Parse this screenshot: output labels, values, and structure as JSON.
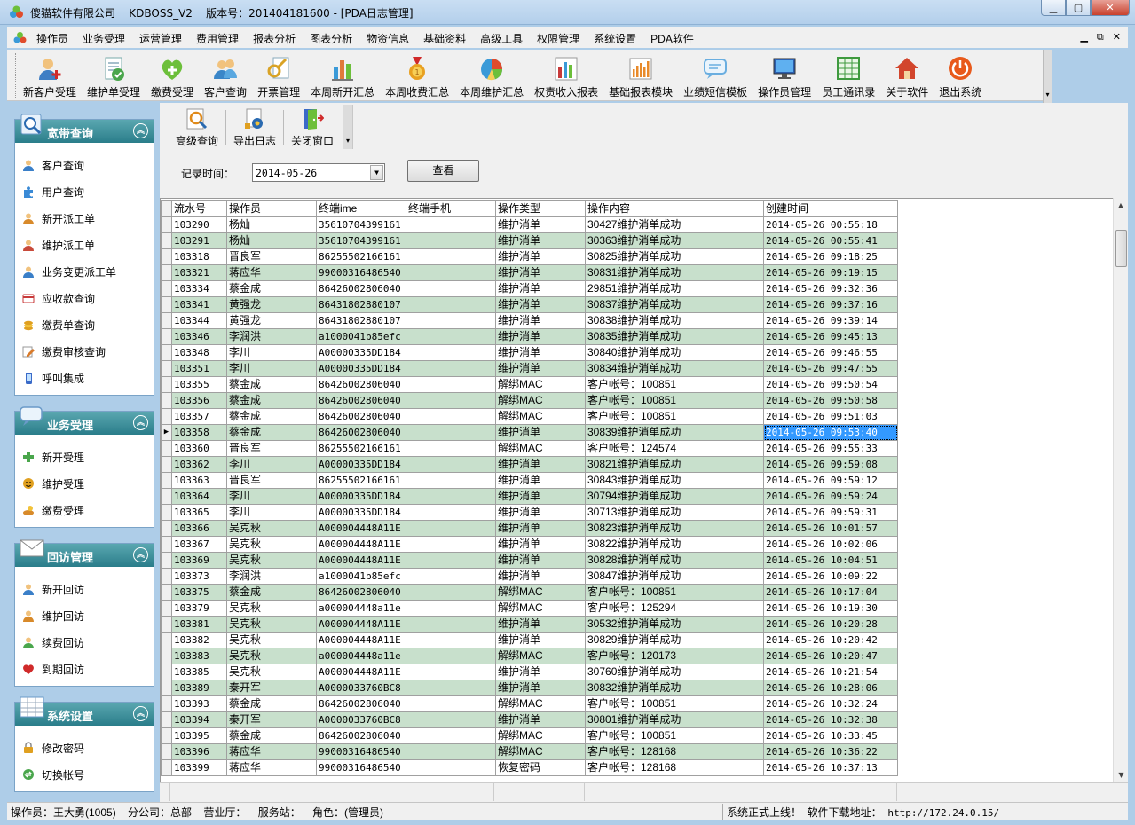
{
  "window": {
    "title": "傻猫软件有限公司    KDBOSS_V2    版本号：201404181600 - [PDA日志管理]",
    "min": "▁",
    "max": "▢",
    "close": "✕"
  },
  "menu": {
    "items": [
      "操作员",
      "业务受理",
      "运营管理",
      "费用管理",
      "报表分析",
      "图表分析",
      "物资信息",
      "基础资料",
      "高级工具",
      "权限管理",
      "系统设置",
      "PDA软件"
    ],
    "mdi": [
      "▁",
      "⧉",
      "✕"
    ]
  },
  "toolbar": {
    "items": [
      {
        "label": "新客户受理",
        "icon": "user-add-icon",
        "color": "#3f7ec4"
      },
      {
        "label": "维护单受理",
        "icon": "document-check-icon",
        "color": "#4aa64c"
      },
      {
        "label": "缴费受理",
        "icon": "heart-plus-icon",
        "color": "#6cbf3a"
      },
      {
        "label": "客户查询",
        "icon": "users-icon",
        "color": "#3a86c8"
      },
      {
        "label": "开票管理",
        "icon": "key-document-icon",
        "color": "#d9a326"
      },
      {
        "label": "本周新开汇总",
        "icon": "bar-chart-icon",
        "color": "#e07a3a"
      },
      {
        "label": "本周收费汇总",
        "icon": "medal-icon",
        "color": "#e8a020"
      },
      {
        "label": "本周维护汇总",
        "icon": "pie-chart-icon",
        "color": "#e04c2c"
      },
      {
        "label": "权责收入报表",
        "icon": "column-chart-icon",
        "color": "#c83a3a"
      },
      {
        "label": "基础报表模块",
        "icon": "report-chart-icon",
        "color": "#e88a2a"
      },
      {
        "label": "业绩短信模板",
        "icon": "message-icon",
        "color": "#6aaee0"
      },
      {
        "label": "操作员管理",
        "icon": "monitor-icon",
        "color": "#2b5fb0"
      },
      {
        "label": "员工通讯录",
        "icon": "spreadsheet-icon",
        "color": "#3e9a3e"
      },
      {
        "label": "关于软件",
        "icon": "home-icon",
        "color": "#d2452c"
      },
      {
        "label": "退出系统",
        "icon": "power-icon",
        "color": "#e85a1c"
      }
    ],
    "chevron": "▾"
  },
  "sidebar": {
    "panels": [
      {
        "title": "宽带查询",
        "icon": "search-panel-icon",
        "items": [
          {
            "label": "客户查询",
            "icon": "person-icon",
            "color": "#3a7fc8"
          },
          {
            "label": "用户查询",
            "icon": "puzzle-icon",
            "color": "#3a8ad6"
          },
          {
            "label": "新开派工单",
            "icon": "person-icon",
            "color": "#d88a2a"
          },
          {
            "label": "维护派工单",
            "icon": "person-icon",
            "color": "#c84a3a"
          },
          {
            "label": "业务变更派工单",
            "icon": "person-icon",
            "color": "#3a7fc8"
          },
          {
            "label": "应收款查询",
            "icon": "card-icon",
            "color": "#c83a3a"
          },
          {
            "label": "缴费单查询",
            "icon": "coins-icon",
            "color": "#e0a020"
          },
          {
            "label": "缴费审核查询",
            "icon": "edit-icon",
            "color": "#d87a2a"
          },
          {
            "label": "呼叫集成",
            "icon": "phone-icon",
            "color": "#3a6ac8"
          }
        ]
      },
      {
        "title": "业务受理",
        "icon": "chat-panel-icon",
        "items": [
          {
            "label": "新开受理",
            "icon": "plus-icon",
            "color": "#4aa64c"
          },
          {
            "label": "维护受理",
            "icon": "smile-icon",
            "color": "#e0a020"
          },
          {
            "label": "缴费受理",
            "icon": "hand-coin-icon",
            "color": "#d88a2a"
          }
        ]
      },
      {
        "title": "回访管理",
        "icon": "mail-panel-icon",
        "items": [
          {
            "label": "新开回访",
            "icon": "person-icon",
            "color": "#3a7fc8"
          },
          {
            "label": "维护回访",
            "icon": "person-icon",
            "color": "#d88a2a"
          },
          {
            "label": "续费回访",
            "icon": "person-icon",
            "color": "#4aa64c"
          },
          {
            "label": "到期回访",
            "icon": "heart-icon",
            "color": "#d02a2a"
          }
        ]
      },
      {
        "title": "系统设置",
        "icon": "table-panel-icon",
        "items": [
          {
            "label": "修改密码",
            "icon": "lock-icon",
            "color": "#e0a020"
          },
          {
            "label": "切换帐号",
            "icon": "switch-icon",
            "color": "#4aa64c"
          }
        ]
      }
    ],
    "collapse_symbol": "︽"
  },
  "child": {
    "toolbar": [
      {
        "label": "高级查询",
        "icon": "magnifier-icon"
      },
      {
        "label": "导出日志",
        "icon": "export-gear-icon"
      },
      {
        "label": "关闭窗口",
        "icon": "door-icon"
      }
    ],
    "filter_label": "记录时间：",
    "date_value": "2014-05-26",
    "date_drop": "▼",
    "query_button": "查看"
  },
  "grid": {
    "columns": [
      "流水号",
      "操作员",
      "终端ime",
      "终端手机",
      "操作类型",
      "操作内容",
      "创建时间"
    ],
    "selected_row": 13,
    "rows": [
      [
        "103290",
        "杨灿",
        "35610704399161",
        "",
        "维护消单",
        "30427维护消单成功",
        "2014-05-26 00:55:18"
      ],
      [
        "103291",
        "杨灿",
        "35610704399161",
        "",
        "维护消单",
        "30363维护消单成功",
        "2014-05-26 00:55:41"
      ],
      [
        "103318",
        "晋良军",
        "86255502166161",
        "",
        "维护消单",
        "30825维护消单成功",
        "2014-05-26 09:18:25"
      ],
      [
        "103321",
        "蒋应华",
        "99000316486540",
        "",
        "维护消单",
        "30831维护消单成功",
        "2014-05-26 09:19:15"
      ],
      [
        "103334",
        "蔡金成",
        "86426002806040",
        "",
        "维护消单",
        "29851维护消单成功",
        "2014-05-26 09:32:36"
      ],
      [
        "103341",
        "黄强龙",
        "86431802880107",
        "",
        "维护消单",
        "30837维护消单成功",
        "2014-05-26 09:37:16"
      ],
      [
        "103344",
        "黄强龙",
        "86431802880107",
        "",
        "维护消单",
        "30838维护消单成功",
        "2014-05-26 09:39:14"
      ],
      [
        "103346",
        "李润洪",
        "a1000041b85efc",
        "",
        "维护消单",
        "30835维护消单成功",
        "2014-05-26 09:45:13"
      ],
      [
        "103348",
        "李川",
        "A00000335DD184",
        "",
        "维护消单",
        "30840维护消单成功",
        "2014-05-26 09:46:55"
      ],
      [
        "103351",
        "李川",
        "A00000335DD184",
        "",
        "维护消单",
        "30834维护消单成功",
        "2014-05-26 09:47:55"
      ],
      [
        "103355",
        "蔡金成",
        "86426002806040",
        "",
        "解绑MAC",
        "客户帐号：100851",
        "2014-05-26 09:50:54"
      ],
      [
        "103356",
        "蔡金成",
        "86426002806040",
        "",
        "解绑MAC",
        "客户帐号：100851",
        "2014-05-26 09:50:58"
      ],
      [
        "103357",
        "蔡金成",
        "86426002806040",
        "",
        "解绑MAC",
        "客户帐号：100851",
        "2014-05-26 09:51:03"
      ],
      [
        "103358",
        "蔡金成",
        "86426002806040",
        "",
        "维护消单",
        "30839维护消单成功",
        "2014-05-26 09:53:40"
      ],
      [
        "103360",
        "晋良军",
        "86255502166161",
        "",
        "解绑MAC",
        "客户帐号：124574",
        "2014-05-26 09:55:33"
      ],
      [
        "103362",
        "李川",
        "A00000335DD184",
        "",
        "维护消单",
        "30821维护消单成功",
        "2014-05-26 09:59:08"
      ],
      [
        "103363",
        "晋良军",
        "86255502166161",
        "",
        "维护消单",
        "30843维护消单成功",
        "2014-05-26 09:59:12"
      ],
      [
        "103364",
        "李川",
        "A00000335DD184",
        "",
        "维护消单",
        "30794维护消单成功",
        "2014-05-26 09:59:24"
      ],
      [
        "103365",
        "李川",
        "A00000335DD184",
        "",
        "维护消单",
        "30713维护消单成功",
        "2014-05-26 09:59:31"
      ],
      [
        "103366",
        "吴克秋",
        "A000004448A11E",
        "",
        "维护消单",
        "30823维护消单成功",
        "2014-05-26 10:01:57"
      ],
      [
        "103367",
        "吴克秋",
        "A000004448A11E",
        "",
        "维护消单",
        "30822维护消单成功",
        "2014-05-26 10:02:06"
      ],
      [
        "103369",
        "吴克秋",
        "A000004448A11E",
        "",
        "维护消单",
        "30828维护消单成功",
        "2014-05-26 10:04:51"
      ],
      [
        "103373",
        "李润洪",
        "a1000041b85efc",
        "",
        "维护消单",
        "30847维护消单成功",
        "2014-05-26 10:09:22"
      ],
      [
        "103375",
        "蔡金成",
        "86426002806040",
        "",
        "解绑MAC",
        "客户帐号：100851",
        "2014-05-26 10:17:04"
      ],
      [
        "103379",
        "吴克秋",
        "a000004448a11e",
        "",
        "解绑MAC",
        "客户帐号：125294",
        "2014-05-26 10:19:30"
      ],
      [
        "103381",
        "吴克秋",
        "A000004448A11E",
        "",
        "维护消单",
        "30532维护消单成功",
        "2014-05-26 10:20:28"
      ],
      [
        "103382",
        "吴克秋",
        "A000004448A11E",
        "",
        "维护消单",
        "30829维护消单成功",
        "2014-05-26 10:20:42"
      ],
      [
        "103383",
        "吴克秋",
        "a000004448a11e",
        "",
        "解绑MAC",
        "客户帐号：120173",
        "2014-05-26 10:20:47"
      ],
      [
        "103385",
        "吴克秋",
        "A000004448A11E",
        "",
        "维护消单",
        "30760维护消单成功",
        "2014-05-26 10:21:54"
      ],
      [
        "103389",
        "秦开军",
        "A0000033760BC8",
        "",
        "维护消单",
        "30832维护消单成功",
        "2014-05-26 10:28:06"
      ],
      [
        "103393",
        "蔡金成",
        "86426002806040",
        "",
        "解绑MAC",
        "客户帐号：100851",
        "2014-05-26 10:32:24"
      ],
      [
        "103394",
        "秦开军",
        "A0000033760BC8",
        "",
        "维护消单",
        "30801维护消单成功",
        "2014-05-26 10:32:38"
      ],
      [
        "103395",
        "蔡金成",
        "86426002806040",
        "",
        "解绑MAC",
        "客户帐号：100851",
        "2014-05-26 10:33:45"
      ],
      [
        "103396",
        "蒋应华",
        "99000316486540",
        "",
        "解绑MAC",
        "客户帐号：128168",
        "2014-05-26 10:36:22"
      ],
      [
        "103399",
        "蒋应华",
        "99000316486540",
        "",
        "恢复密码",
        "客户帐号：128168",
        "2014-05-26 10:37:13"
      ]
    ]
  },
  "statusbar": {
    "left": "操作员：王大勇(1005)    分公司：总部    营业厅：    服务站：    角色：(管理员)",
    "right_label": "系统正式上线！  软件下载地址：  ",
    "right_url": "http://172.24.0.15/"
  }
}
